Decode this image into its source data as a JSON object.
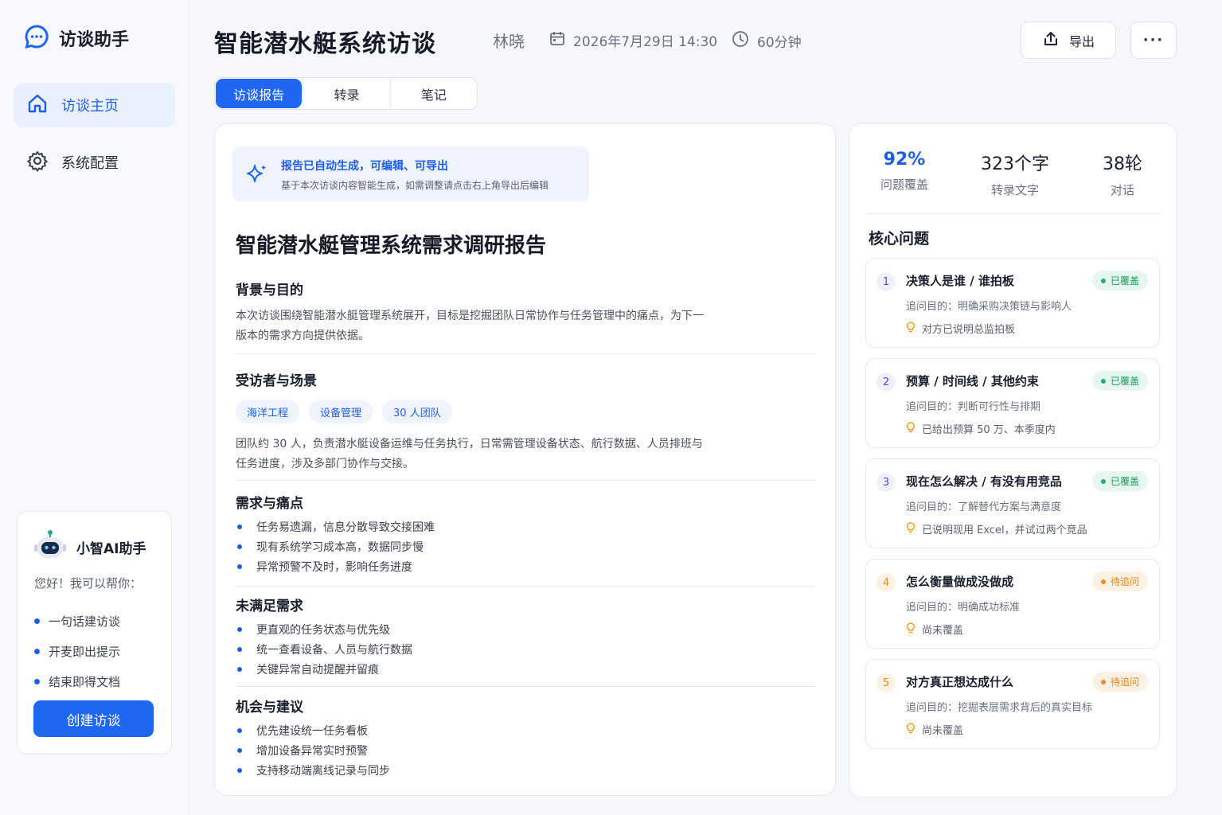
{
  "app": {
    "name": "访谈助手"
  },
  "nav": [
    {
      "label": "访谈主页",
      "icon": "home-icon"
    },
    {
      "label": "系统配置",
      "icon": "gear-icon"
    }
  ],
  "assistant": {
    "name": "小智AI助手",
    "greeting": "您好！我可以帮你：",
    "items": [
      "一句话建访谈",
      "开麦即出提示",
      "结束即得文档"
    ],
    "create_label": "创建访谈"
  },
  "header": {
    "title": "智能潜水艇系统访谈",
    "person": "林晓",
    "datetime": "2026年7月29日 14:30",
    "duration": "60分钟",
    "export_label": "导出",
    "more_label": "···"
  },
  "tabs": [
    "访谈报告",
    "转录",
    "笔记"
  ],
  "report": {
    "notice_title": "报告已自动生成，可编辑、可导出",
    "notice_sub": "基于本次访谈内容智能生成，如需调整请点击右上角导出后编辑",
    "title": "智能潜水艇管理系统需求调研报告",
    "background": {
      "heading": "背景与目的",
      "text": "本次访谈围绕智能潜水艇管理系统展开，目标是挖掘团队日常协作与任务管理中的痛点，为下一版本的需求方向提供依据。"
    },
    "interviewee": {
      "heading": "受访者与场景",
      "tags": [
        "海洋工程",
        "设备管理",
        "30 人团队"
      ],
      "text": "团队约 30 人，负责潜水艇设备运维与任务执行，日常需管理设备状态、航行数据、人员排班与任务进度，涉及多部门协作与交接。"
    },
    "pain": {
      "heading": "需求与痛点",
      "items": [
        "任务易遗漏，信息分散导致交接困难",
        "现有系统学习成本高，数据同步慢",
        "异常预警不及时，影响任务进度"
      ]
    },
    "unmet": {
      "heading": "未满足需求",
      "items": [
        "更直观的任务状态与优先级",
        "统一查看设备、人员与航行数据",
        "关键异常自动提醒并留痕"
      ]
    },
    "suggest": {
      "heading": "机会与建议",
      "items": [
        "优先建设统一任务看板",
        "增加设备异常实时预警",
        "支持移动端离线记录与同步"
      ]
    }
  },
  "stats": [
    {
      "value": "92%",
      "label": "问题覆盖"
    },
    {
      "value": "323个字",
      "label": "转录文字"
    },
    {
      "value": "38轮",
      "label": "对话"
    }
  ],
  "core": {
    "heading": "核心问题",
    "questions": [
      {
        "num": "1",
        "title": "决策人是谁 / 谁拍板",
        "status": "已覆盖",
        "purpose": "追问目的：明确采购决策链与影响人",
        "note": "对方已说明总监拍板"
      },
      {
        "num": "2",
        "title": "预算 / 时间线 / 其他约束",
        "status": "已覆盖",
        "purpose": "追问目的：判断可行性与排期",
        "note": "已给出预算 50 万、本季度内"
      },
      {
        "num": "3",
        "title": "现在怎么解决 / 有没有用竞品",
        "status": "已覆盖",
        "purpose": "追问目的：了解替代方案与满意度",
        "note": "已说明现用 Excel，并试过两个竞品"
      },
      {
        "num": "4",
        "title": "怎么衡量做成没做成",
        "status": "待追问",
        "purpose": "追问目的：明确成功标准",
        "note": "尚未覆盖"
      },
      {
        "num": "5",
        "title": "对方真正想达成什么",
        "status": "待追问",
        "purpose": "追问目的：挖掘表层需求背后的真实目标",
        "note": "尚未覆盖"
      }
    ]
  },
  "colors": {
    "accent": "#1f66f0",
    "covered": "#1fb36a",
    "pending": "#f08a1f"
  }
}
